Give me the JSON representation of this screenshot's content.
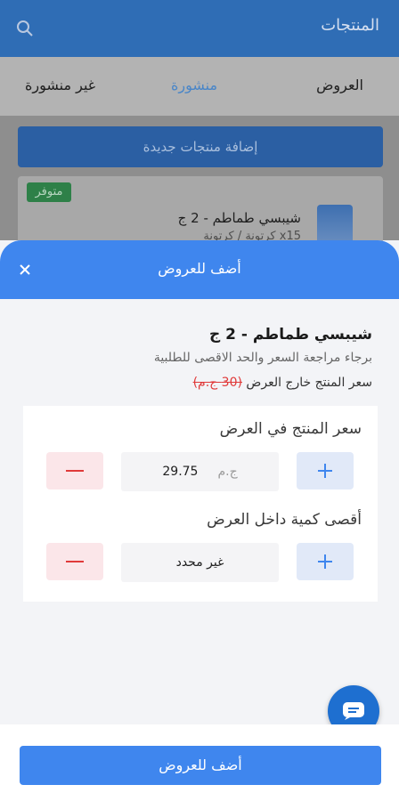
{
  "app": {
    "title": "المنتجات",
    "tabs": [
      {
        "label": "العروض",
        "active": false
      },
      {
        "label": "منشورة",
        "active": true
      },
      {
        "label": "غير منشورة",
        "active": false
      }
    ],
    "add_products_label": "إضافة منتجات جديدة",
    "product_card": {
      "badge": "متوفر",
      "name": "شيبسي طماطم - 2 ج",
      "desc": "كرتونة / كرتونة x15"
    }
  },
  "sheet": {
    "title": "أضف للعروض",
    "product_name": "شيبسي طماطم - 2 ج",
    "hint": "برجاء مراجعة السعر والحد الاقصى للطلبية",
    "outside_label": "سعر المنتج خارج العرض",
    "outside_price": "(30 ج.م)",
    "price_field": {
      "label": "سعر المنتج في العرض",
      "value": "29.75",
      "unit": "ج.م"
    },
    "max_field": {
      "label": "أقصى كمية داخل العرض",
      "value": "غير محدد"
    },
    "submit_label": "أضف للعروض"
  },
  "colors": {
    "accent": "#3f86ee",
    "minus": "#e03a3a",
    "plus_bg": "#e1e9f8",
    "minus_bg": "#fbe6e9"
  }
}
